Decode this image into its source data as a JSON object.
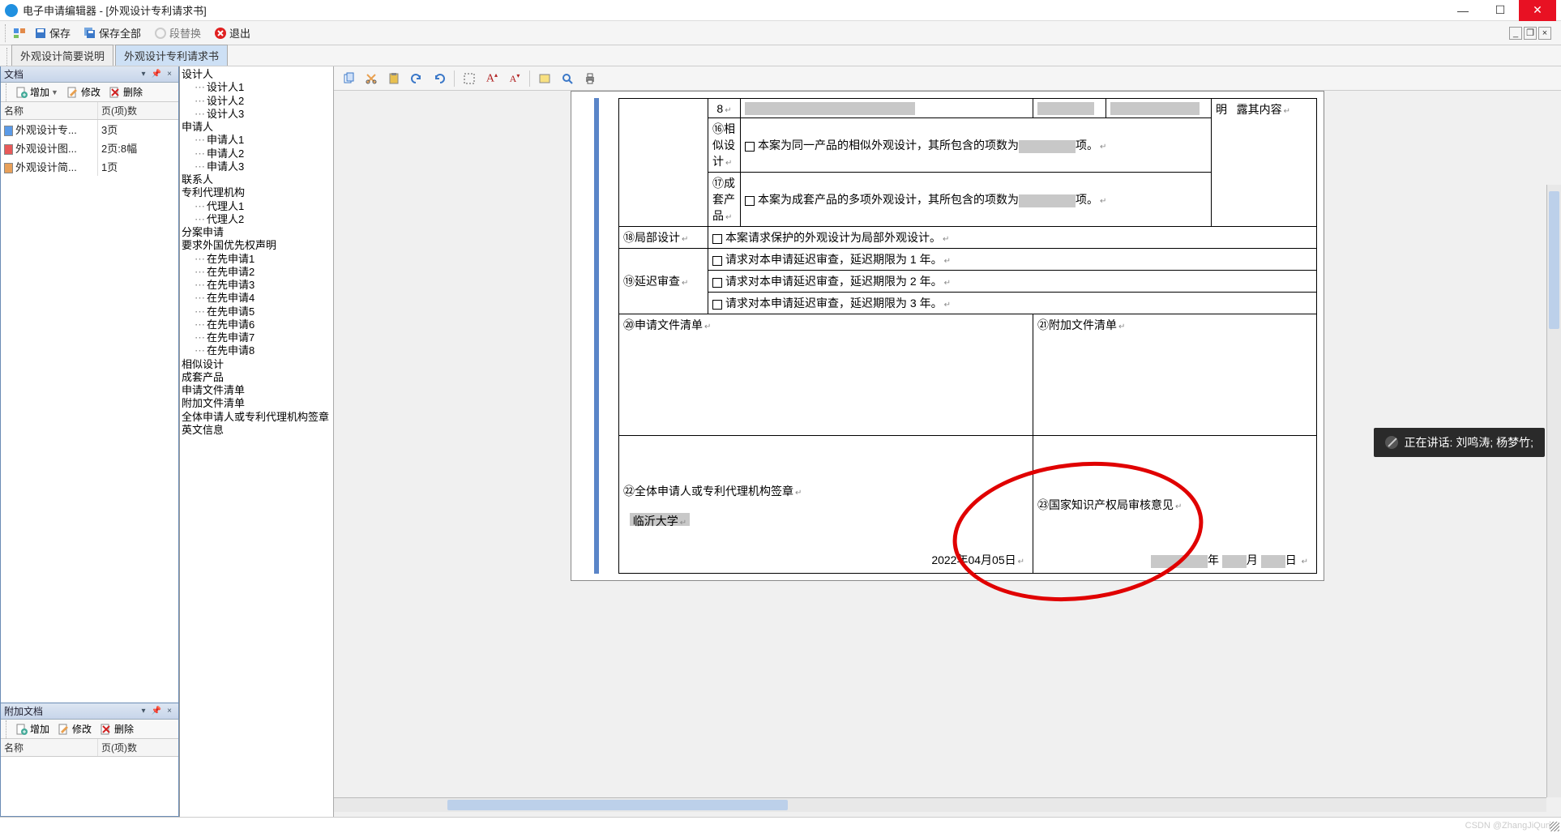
{
  "titlebar": {
    "title": "电子申请编辑器 - [外观设计专利请求书]"
  },
  "toolbar": {
    "save": "保存",
    "save_all": "保存全部",
    "seg_replace": "段替换",
    "exit": "退出"
  },
  "tabs": [
    {
      "label": "外观设计简要说明",
      "active": false
    },
    {
      "label": "外观设计专利请求书",
      "active": true
    }
  ],
  "panel_doc": {
    "title": "文档",
    "tb_add": "增加",
    "tb_modify": "修改",
    "tb_delete": "删除",
    "col_name": "名称",
    "col_pages": "页(项)数",
    "rows": [
      {
        "icon": "blue",
        "name": "外观设计专...",
        "pages": "3页"
      },
      {
        "icon": "red",
        "name": "外观设计图...",
        "pages": "2页:8幅"
      },
      {
        "icon": "orange",
        "name": "外观设计简...",
        "pages": "1页"
      }
    ]
  },
  "panel_att": {
    "title": "附加文档",
    "tb_add": "增加",
    "tb_modify": "修改",
    "tb_delete": "删除",
    "col_name": "名称",
    "col_pages": "页(项)数"
  },
  "outline": [
    {
      "label": "设计人",
      "children": [
        "设计人1",
        "设计人2",
        "设计人3"
      ]
    },
    {
      "label": "申请人",
      "children": [
        "申请人1",
        "申请人2",
        "申请人3"
      ]
    },
    {
      "label": "联系人"
    },
    {
      "label": "专利代理机构",
      "children": [
        "代理人1",
        "代理人2"
      ]
    },
    {
      "label": "分案申请"
    },
    {
      "label": "要求外国优先权声明",
      "children": [
        "在先申请1",
        "在先申请2",
        "在先申请3",
        "在先申请4",
        "在先申请5",
        "在先申请6",
        "在先申请7",
        "在先申请8"
      ]
    },
    {
      "label": "相似设计"
    },
    {
      "label": "成套产品"
    },
    {
      "label": "申请文件清单"
    },
    {
      "label": "附加文件清单"
    },
    {
      "label": "全体申请人或专利代理机构签章"
    },
    {
      "label": "英文信息"
    }
  ],
  "form": {
    "row15_num": "8",
    "row15_tail1": "明",
    "row15_tail2": "露其内容",
    "r16_label": "⑯相似设计",
    "r16_text": "本案为同一产品的相似外观设计，其所包含的项数为",
    "r16_tail": "项。",
    "r17_label": "⑰成套产品",
    "r17_text": "本案为成套产品的多项外观设计，其所包含的项数为",
    "r17_tail": "项。",
    "r18_label": "⑱局部设计",
    "r18_text": "本案请求保护的外观设计为局部外观设计。",
    "r19_label": "⑲延迟审查",
    "r19_1": "请求对本申请延迟审查，延迟期限为 1 年。",
    "r19_2": "请求对本申请延迟审查，延迟期限为 2 年。",
    "r19_3": "请求对本申请延迟审查，延迟期限为 3 年。",
    "r20_label": "⑳申请文件清单",
    "r21_label": "㉑附加文件清单",
    "r22_label": "㉒全体申请人或专利代理机构签章",
    "r22_value": "临沂大学",
    "r22_date": "2022年04月05日",
    "r23_label": "㉓国家知识产权局审核意见",
    "r23_date_y": "年",
    "r23_date_m": "月",
    "r23_date_d": "日"
  },
  "toast": {
    "text": "正在讲话: 刘鸣涛; 杨梦竹;"
  },
  "footer": {
    "watermark": "CSDN @ZhangJiQun."
  }
}
